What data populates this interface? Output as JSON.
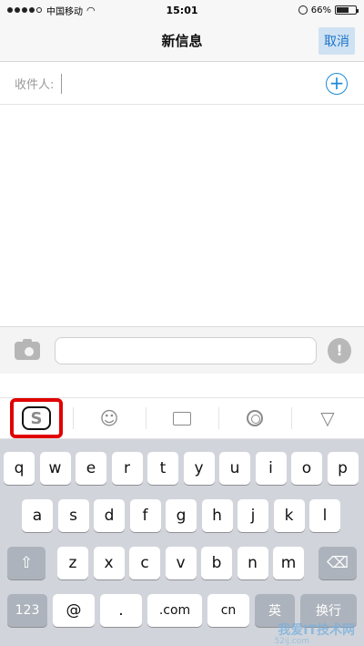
{
  "status_bar": {
    "signal_filled": 4,
    "signal_empty": 1,
    "carrier": "中国移动",
    "time": "15:01",
    "battery_text": "66%",
    "battery_level": 0.66
  },
  "nav": {
    "title": "新信息",
    "cancel_label": "取消"
  },
  "recipient": {
    "label": "收件人:",
    "value": "",
    "add_icon": "plus-circle-icon"
  },
  "compose": {
    "camera_icon": "camera-icon",
    "message_value": "",
    "mic_icon": "microphone-icon"
  },
  "keyboard_toolbar": {
    "logo_letter": "S",
    "items": [
      "sogou-logo",
      "emoji-icon",
      "keyboard-icon",
      "gear-icon",
      "collapse-icon"
    ],
    "highlight_color": "#e10000"
  },
  "keyboard": {
    "row1": [
      "q",
      "w",
      "e",
      "r",
      "t",
      "y",
      "u",
      "i",
      "o",
      "p"
    ],
    "row2": [
      "a",
      "s",
      "d",
      "f",
      "g",
      "h",
      "j",
      "k",
      "l"
    ],
    "row3": [
      "z",
      "x",
      "c",
      "v",
      "b",
      "n",
      "m"
    ],
    "shift_icon": "shift-icon",
    "delete_icon": "backspace-icon",
    "bottom": {
      "numbers": "123",
      "at": "@",
      "dot": ".",
      "com": ".com",
      "cn": "cn",
      "lang": "英",
      "return": "换行"
    }
  },
  "watermark": {
    "text": "我爱IT技术网",
    "sub": "52ij.com"
  }
}
